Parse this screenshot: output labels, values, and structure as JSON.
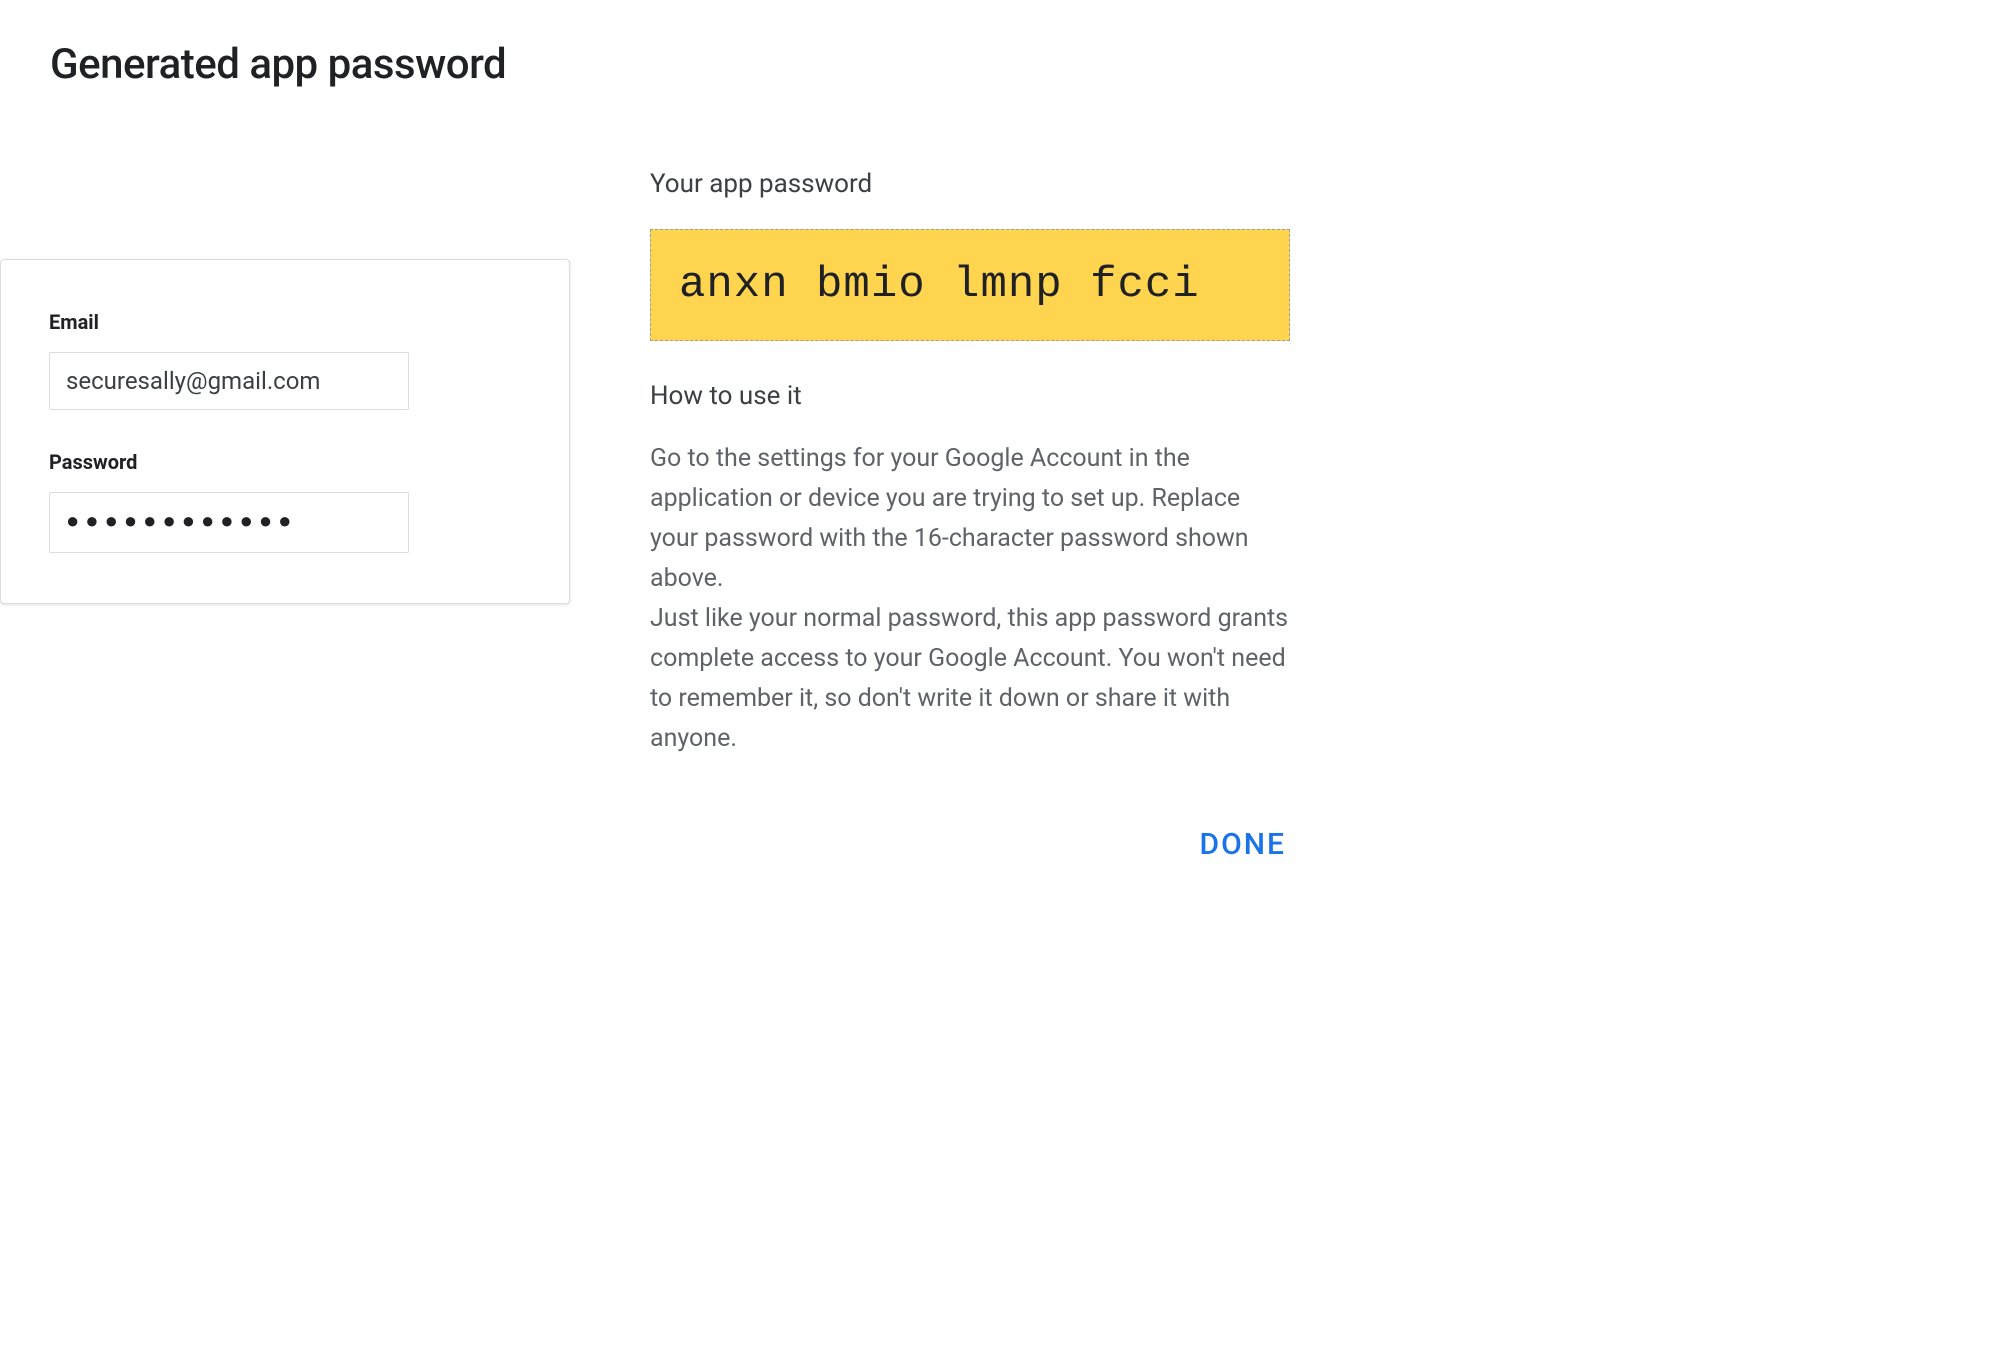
{
  "page": {
    "title": "Generated app password"
  },
  "form": {
    "email_label": "Email",
    "email_value": "securesally@gmail.com",
    "password_label": "Password",
    "password_masked": "●●●●●●●●●●●●"
  },
  "app_password": {
    "heading": "Your app password",
    "value": "anxn bmio lmnp fcci",
    "howto_heading": "How to use it",
    "instructions_p1": "Go to the settings for your Google Account in the application or device you are trying to set up. Replace your password with the 16-character password shown above.",
    "instructions_p2": "Just like your normal password, this app password grants complete access to your Google Account. You won't need to remember it, so don't write it down or share it with anyone."
  },
  "actions": {
    "done_label": "DONE"
  }
}
